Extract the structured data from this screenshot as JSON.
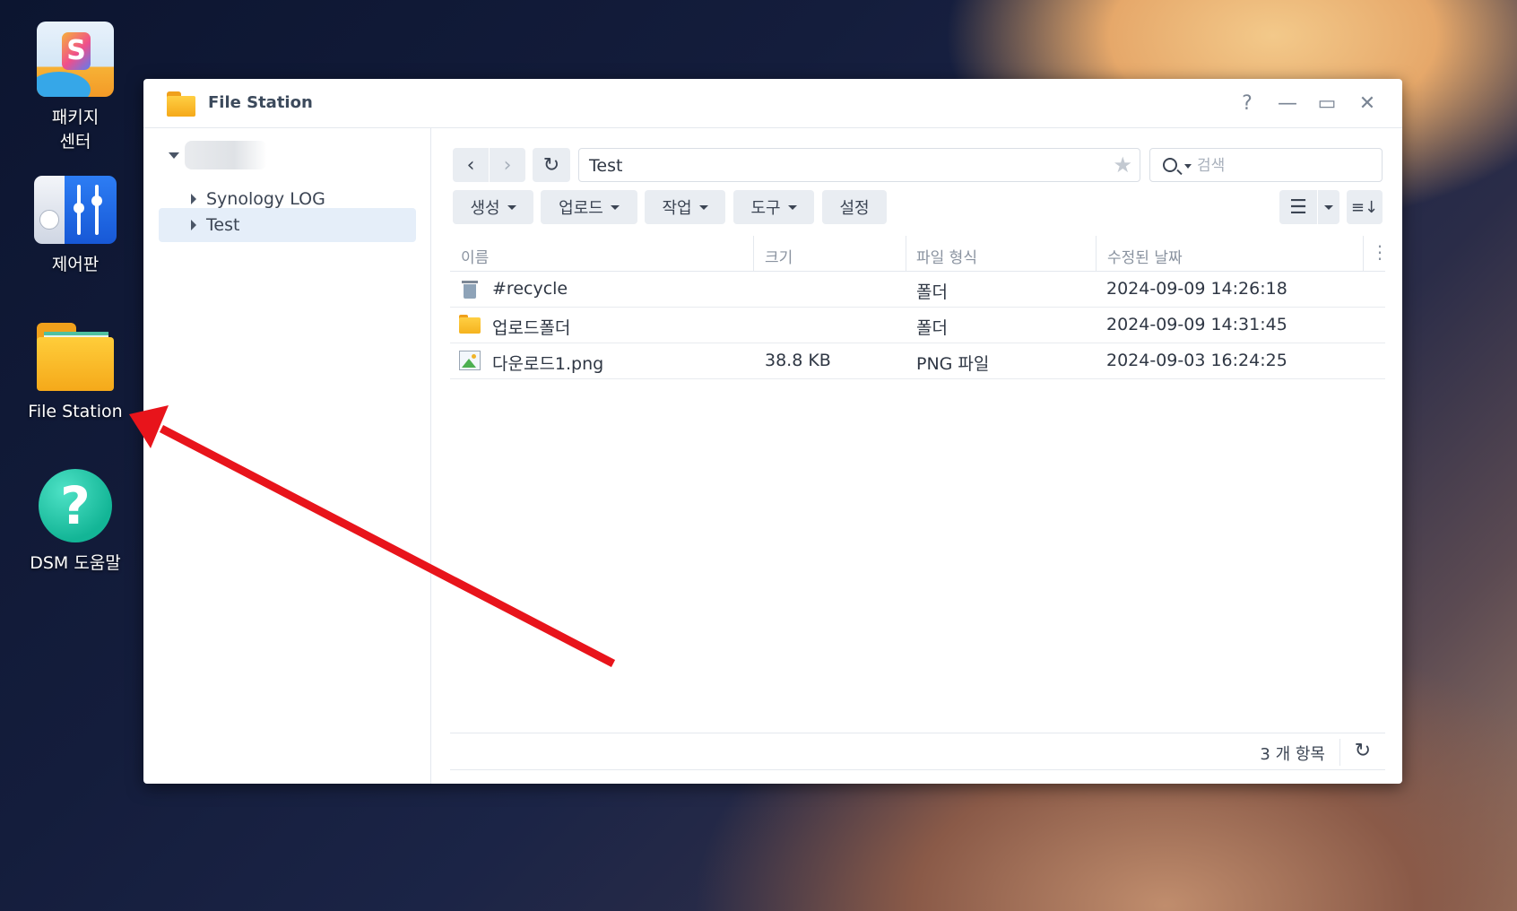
{
  "desktop": {
    "icons": [
      {
        "label": "패키지\n센터",
        "icon": "package-center-icon"
      },
      {
        "label": "제어판",
        "icon": "control-panel-icon"
      },
      {
        "label": "File Station",
        "icon": "file-station-icon"
      },
      {
        "label": "DSM 도움말",
        "icon": "dsm-help-icon"
      }
    ]
  },
  "window": {
    "title": "File Station",
    "controls": {
      "help": "?",
      "minimize": "—",
      "maximize": "▭",
      "close": "✕"
    }
  },
  "tree": {
    "nodes": [
      {
        "label": "Synology LOG",
        "selected": false
      },
      {
        "label": "Test",
        "selected": true
      }
    ]
  },
  "toolbar": {
    "path": "Test",
    "search_placeholder": "검색",
    "menus": [
      "생성",
      "업로드",
      "작업",
      "도구"
    ],
    "settings": "설정"
  },
  "grid": {
    "columns": [
      "이름",
      "크기",
      "파일 형식",
      "수정된 날짜"
    ],
    "rows": [
      {
        "icon": "recycle-bin-icon",
        "name": "#recycle",
        "size": "",
        "type": "폴더",
        "modified": "2024-09-09 14:26:18"
      },
      {
        "icon": "folder-icon",
        "name": "업로드폴더",
        "size": "",
        "type": "폴더",
        "modified": "2024-09-09 14:31:45"
      },
      {
        "icon": "image-file-icon",
        "name": "다운로드1.png",
        "size": "38.8 KB",
        "type": "PNG 파일",
        "modified": "2024-09-03 16:24:25"
      }
    ]
  },
  "status": {
    "count": "3 개 항목"
  },
  "colors": {
    "selection": "#e5eef9",
    "annotation_arrow": "#e8141b",
    "button_bg": "#e9edf2"
  }
}
